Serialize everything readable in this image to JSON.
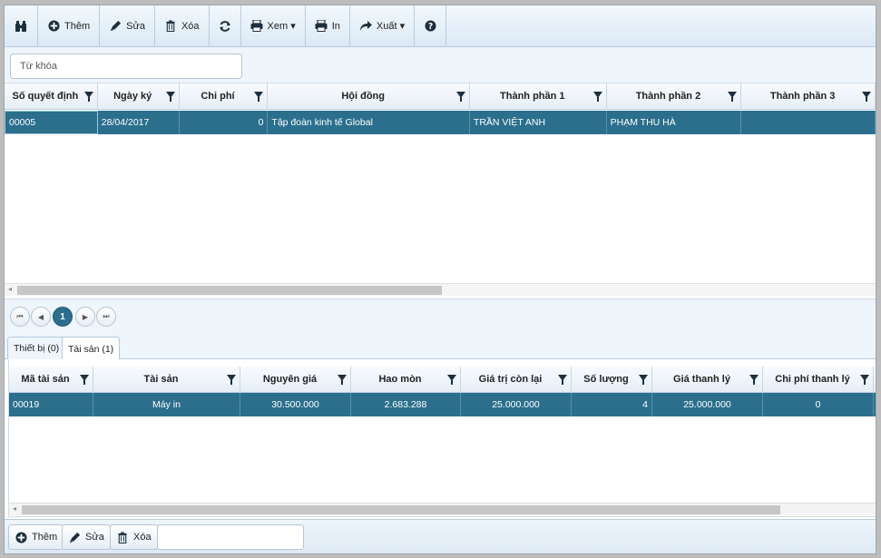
{
  "toolbar": {
    "buttons": [
      {
        "label": "",
        "icon": "binoculars-icon"
      },
      {
        "label": "Thêm",
        "icon": "plus-circle-icon"
      },
      {
        "label": "Sửa",
        "icon": "pencil-icon"
      },
      {
        "label": "Xóa",
        "icon": "trash-icon"
      },
      {
        "label": "",
        "icon": "refresh-icon"
      },
      {
        "label": "Xem ▾",
        "icon": "print-icon"
      },
      {
        "label": "In",
        "icon": "print-icon"
      },
      {
        "label": "Xuất ▾",
        "icon": "share-icon"
      },
      {
        "label": "",
        "icon": "help-icon"
      }
    ]
  },
  "search": {
    "placeholder": "Từ khóa"
  },
  "main_grid": {
    "columns": [
      "Số quyết định",
      "Ngày ký",
      "Chi phí",
      "Hội đồng",
      "Thành phần 1",
      "Thành phần 2",
      "Thành phần 3"
    ],
    "rows": [
      [
        "00005",
        "28/04/2017",
        "0",
        "Tập đoàn kinh tế Global",
        "TRẦN VIỆT ANH",
        "PHẠM THU HÀ",
        ""
      ]
    ]
  },
  "pager": {
    "current_page": "1"
  },
  "tabs": [
    {
      "label": "Thiết bị (0)",
      "active": false
    },
    {
      "label": "Tài sản (1)",
      "active": true
    }
  ],
  "asset_grid": {
    "columns": [
      "Mã tài sản",
      "Tài sản",
      "Nguyên giá",
      "Hao mòn",
      "Giá trị còn lại",
      "Số lượng",
      "Giá thanh lý",
      "Chi phí thanh lý"
    ],
    "rows": [
      [
        "00019",
        "Máy in",
        "30.500.000",
        "2.683.288",
        "25.000.000",
        "4",
        "25.000.000",
        "0"
      ]
    ]
  },
  "bottom_toolbar": {
    "add_label": "Thêm",
    "edit_label": "Sửa",
    "delete_label": "Xóa"
  },
  "colors": {
    "selected_row": "#2b6f8d",
    "toolbar_bg": "#dbe9f5"
  }
}
